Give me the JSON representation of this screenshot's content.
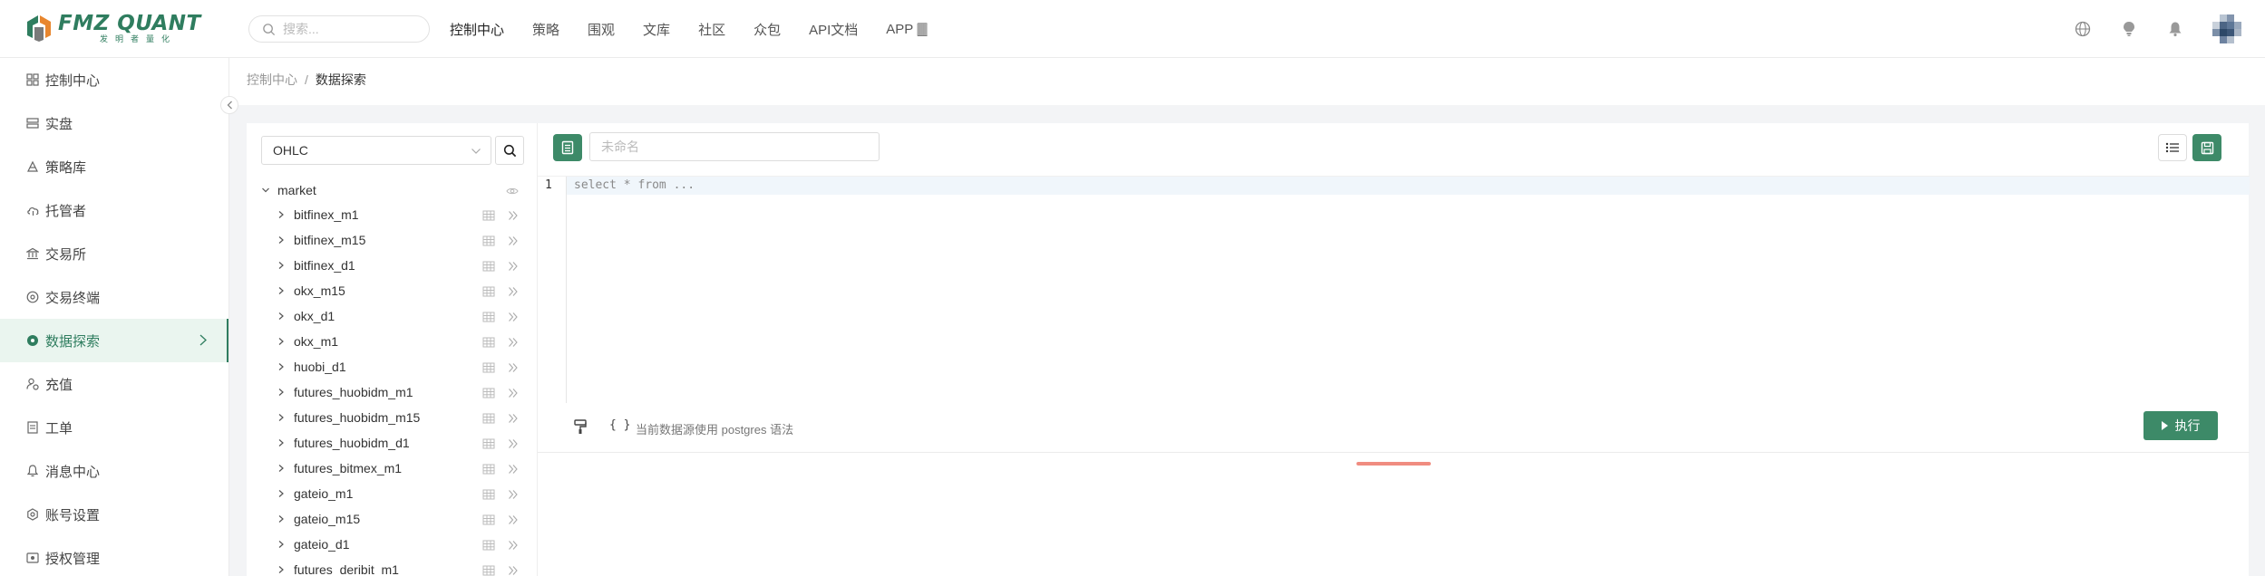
{
  "header": {
    "logo_title": "FMZ QUANT",
    "logo_subtitle": "发明者量化",
    "search_placeholder": "搜索...",
    "nav": [
      "控制中心",
      "策略",
      "围观",
      "文库",
      "社区",
      "众包",
      "API文档",
      "APP 🀫"
    ],
    "icons": [
      "globe-icon",
      "lightbulb-icon",
      "bell-icon",
      "avatar"
    ]
  },
  "sidebar": {
    "items": [
      {
        "label": "控制中心",
        "icon": "dashboard-icon"
      },
      {
        "label": "实盘",
        "icon": "server-icon"
      },
      {
        "label": "策略库",
        "icon": "strategy-icon"
      },
      {
        "label": "托管者",
        "icon": "cloud-icon"
      },
      {
        "label": "交易所",
        "icon": "bank-icon"
      },
      {
        "label": "交易终端",
        "icon": "terminal-icon"
      },
      {
        "label": "数据探索",
        "icon": "data-icon",
        "active": true
      },
      {
        "label": "充值",
        "icon": "user-money-icon"
      },
      {
        "label": "工单",
        "icon": "ticket-icon"
      },
      {
        "label": "消息中心",
        "icon": "bell-icon"
      },
      {
        "label": "账号设置",
        "icon": "gear-icon"
      },
      {
        "label": "授权管理",
        "icon": "license-icon"
      }
    ]
  },
  "breadcrumb": {
    "parent": "控制中心",
    "separator": "/",
    "current": "数据探索"
  },
  "tree": {
    "datasource": "OHLC",
    "root": "market",
    "tables": [
      "bitfinex_m1",
      "bitfinex_m15",
      "bitfinex_d1",
      "okx_m15",
      "okx_d1",
      "okx_m1",
      "huobi_d1",
      "futures_huobidm_m1",
      "futures_huobidm_m15",
      "futures_huobidm_d1",
      "futures_bitmex_m1",
      "gateio_m1",
      "gateio_m15",
      "gateio_d1",
      "futures_deribit_m1"
    ]
  },
  "editor": {
    "name_placeholder": "未命名",
    "line_number": "1",
    "code": "select * from ...",
    "brace_label": "{ }",
    "hint": "当前数据源使用 postgres 语法",
    "run_label": "执行"
  },
  "colors": {
    "accent": "#3d8a68",
    "active_bg": "#eaf5ef",
    "handle": "#f08c80"
  }
}
